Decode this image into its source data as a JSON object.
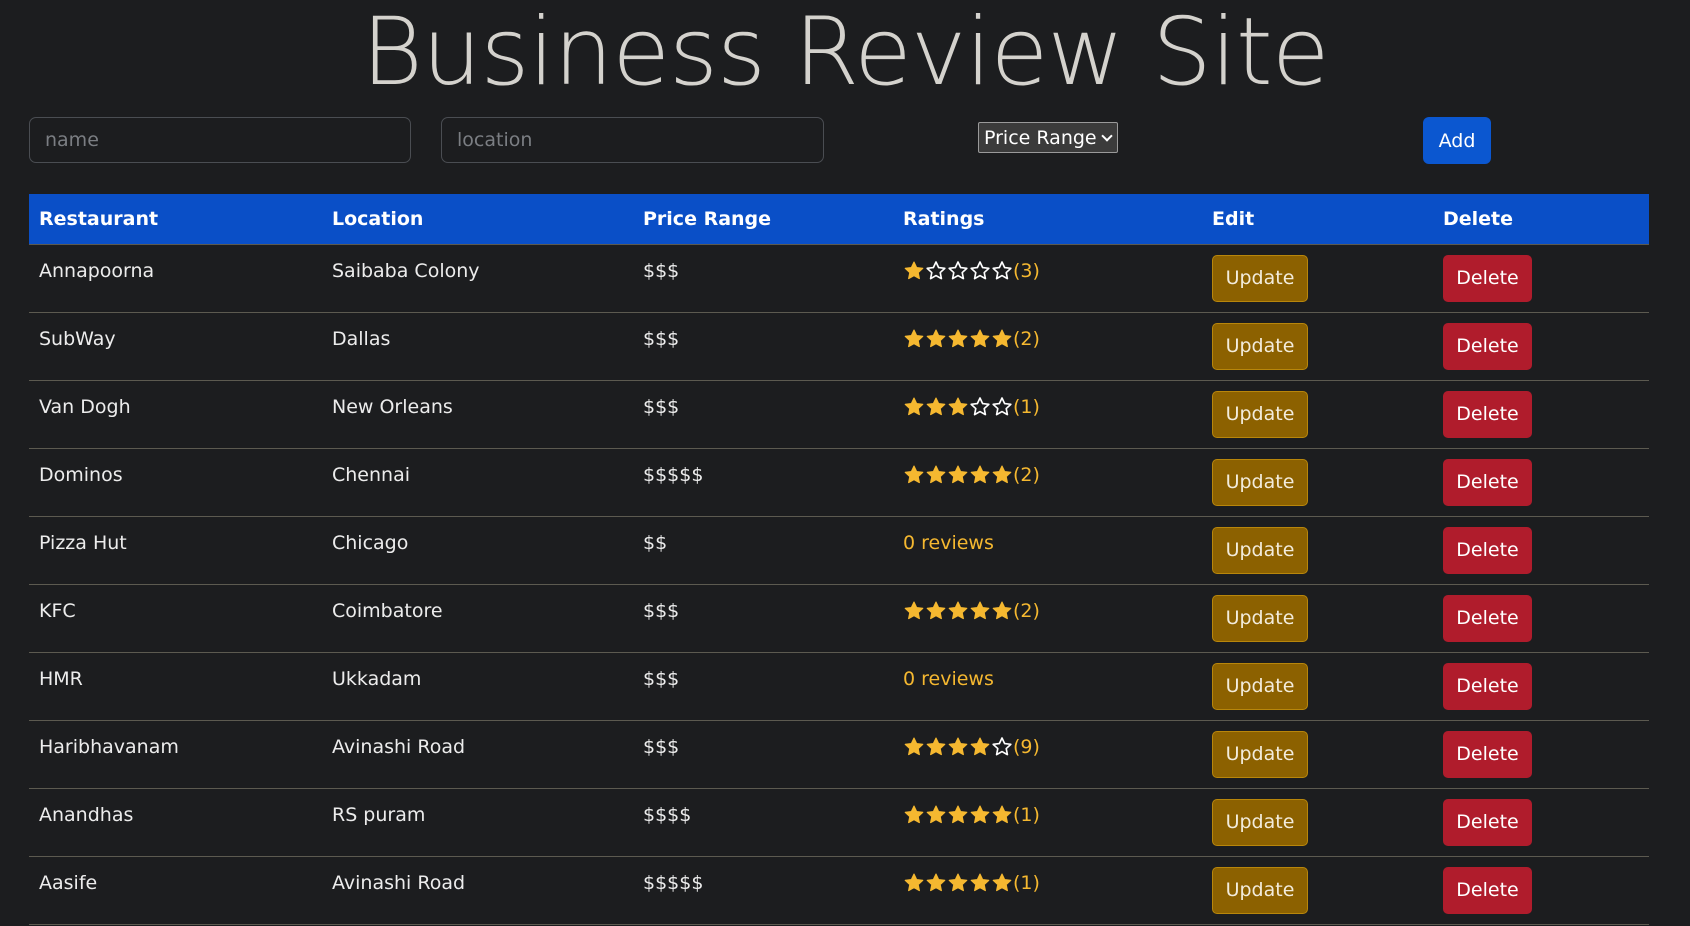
{
  "app": {
    "title": "Business Review Site"
  },
  "form": {
    "name_placeholder": "name",
    "location_placeholder": "location",
    "price_range_label": "Price Range",
    "add_label": "Add"
  },
  "table": {
    "headers": [
      "Restaurant",
      "Location",
      "Price Range",
      "Ratings",
      "Edit",
      "Delete"
    ],
    "update_label": "Update",
    "delete_label": "Delete",
    "no_reviews_label": "0 reviews",
    "rows": [
      {
        "name": "Annapoorna",
        "location": "Saibaba Colony",
        "price": "$$$",
        "stars": 1,
        "count": "(3)",
        "reviewed": true
      },
      {
        "name": "SubWay",
        "location": "Dallas",
        "price": "$$$",
        "stars": 5,
        "count": "(2)",
        "reviewed": true
      },
      {
        "name": "Van Dogh",
        "location": "New Orleans",
        "price": "$$$",
        "stars": 3,
        "count": "(1)",
        "reviewed": true
      },
      {
        "name": "Dominos",
        "location": "Chennai",
        "price": "$$$$$",
        "stars": 5,
        "count": "(2)",
        "reviewed": true
      },
      {
        "name": "Pizza Hut",
        "location": "Chicago",
        "price": "$$",
        "stars": 0,
        "count": "",
        "reviewed": false
      },
      {
        "name": "KFC",
        "location": "Coimbatore",
        "price": "$$$",
        "stars": 5,
        "count": "(2)",
        "reviewed": true
      },
      {
        "name": "HMR",
        "location": "Ukkadam",
        "price": "$$$",
        "stars": 0,
        "count": "",
        "reviewed": false
      },
      {
        "name": "Haribhavanam",
        "location": "Avinashi Road",
        "price": "$$$",
        "stars": 4,
        "count": "(9)",
        "reviewed": true
      },
      {
        "name": "Anandhas",
        "location": "RS puram",
        "price": "$$$$",
        "stars": 5,
        "count": "(1)",
        "reviewed": true
      },
      {
        "name": "Aasife",
        "location": "Avinashi Road",
        "price": "$$$$$",
        "stars": 5,
        "count": "(1)",
        "reviewed": true
      }
    ]
  },
  "colors": {
    "background": "#1c1d1f",
    "header_bg": "#0a4fc7",
    "add_button": "#0b57d0",
    "update_button": "#8c6100",
    "delete_button": "#b01c2c",
    "star_fill": "#f5b830",
    "star_empty_stroke": "#ffffff"
  },
  "icons": {
    "star_filled": "star-filled-icon",
    "star_empty": "star-empty-icon",
    "dropdown": "chevron-down-icon"
  }
}
